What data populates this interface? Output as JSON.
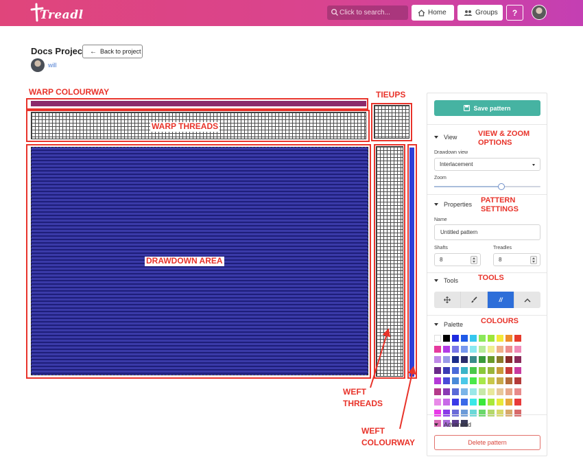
{
  "app": {
    "logo_text": "Treadl"
  },
  "header": {
    "search_placeholder": "Click to search...",
    "home_label": "Home",
    "groups_label": "Groups",
    "help_label": "?"
  },
  "project": {
    "title": "Docs Project",
    "back_label": "Back to project",
    "owner": "will"
  },
  "annotations": {
    "warp_colourway": "WARP COLOURWAY",
    "tieups": "TIEUPS",
    "warp_threads": "WARP THREADS",
    "drawdown_area": "DRAWDOWN AREA",
    "weft_threads": "WEFT\nTHREADS",
    "weft_colourway": "WEFT\nCOLOURWAY",
    "view_zoom": "VIEW & ZOOM\nOPTIONS",
    "pattern_settings": "PATTERN\nSETTINGS",
    "tools": "TOOLS",
    "colours": "COLOURS",
    "annotation_color": "#e8332a"
  },
  "editor": {
    "warp_colour": "#8c2b6b",
    "weft_colour": "#2f3fd8",
    "drawdown_colour": "#3a3aa8"
  },
  "sidebar": {
    "save_label": "Save pattern",
    "view": {
      "title": "View",
      "drawdown_view_label": "Drawdown view",
      "drawdown_view_value": "Interlacement",
      "zoom_label": "Zoom",
      "zoom_level": 0.63
    },
    "properties": {
      "title": "Properties",
      "name_label": "Name",
      "name_placeholder": "Untitled pattern",
      "shafts_label": "Shafts",
      "shafts_value": "8",
      "treadles_label": "Treadles",
      "treadles_value": "8"
    },
    "tools": {
      "title": "Tools",
      "items": [
        {
          "name": "move-icon",
          "active": false
        },
        {
          "name": "paint-brush-icon",
          "active": false
        },
        {
          "label": "//",
          "active": true
        },
        {
          "name": "chevron-up-icon",
          "active": false
        }
      ]
    },
    "palette": {
      "title": "Palette",
      "colors": [
        "#ffffff",
        "#000000",
        "#1f2be0",
        "#1f5ae8",
        "#36c6ee",
        "#8be85a",
        "#9ee63a",
        "#f4e83a",
        "#ee8c2c",
        "#e63a2c",
        "#e63a9e",
        "#b43ae6",
        "#7a78e8",
        "#7898ee",
        "#8ae8f0",
        "#b8ec9a",
        "#eeee90",
        "#f0b08a",
        "#ee8c8c",
        "#f08ab8",
        "#c08ae8",
        "#9a9ae8",
        "#1c2e8a",
        "#2a2a6a",
        "#3a8c8a",
        "#3a9a3a",
        "#6a9a2a",
        "#8a7a2a",
        "#8a2a2a",
        "#8a2a5a",
        "#6a2a8a",
        "#3a3ab4",
        "#4a6ad8",
        "#3ab4c8",
        "#4ac84a",
        "#8ac83a",
        "#9ab43a",
        "#c89a3a",
        "#c83a3a",
        "#c83aa0",
        "#b43ad8",
        "#4a4ad8",
        "#4a8ad8",
        "#4ac8e8",
        "#4ae84a",
        "#a8e84a",
        "#c8c84a",
        "#c8a84a",
        "#b46a3a",
        "#b43a3a",
        "#b43a8a",
        "#8a3ab4",
        "#5a6ad8",
        "#7ab4e8",
        "#9ae8e8",
        "#c8e8a8",
        "#e8e89a",
        "#e8c89a",
        "#e8a88a",
        "#e88a8a",
        "#e88ae8",
        "#c86ae8",
        "#3a3ae8",
        "#3a6ae8",
        "#3ae8e8",
        "#3ae83a",
        "#a8e83a",
        "#e8e83a",
        "#e8a83a",
        "#e83a3a",
        "#e83ae8",
        "#8a3ae8",
        "#6a6ad8",
        "#6a9ad8",
        "#6ad8d8",
        "#6ad86a",
        "#b4d86a",
        "#d8d86a",
        "#d8a86a",
        "#d86a6a",
        "#d86ab4",
        "#a86ad8",
        "#5a3a8a",
        "#3a3a5a"
      ]
    },
    "advanced_title": "Advanced",
    "delete_label": "Delete pattern"
  }
}
